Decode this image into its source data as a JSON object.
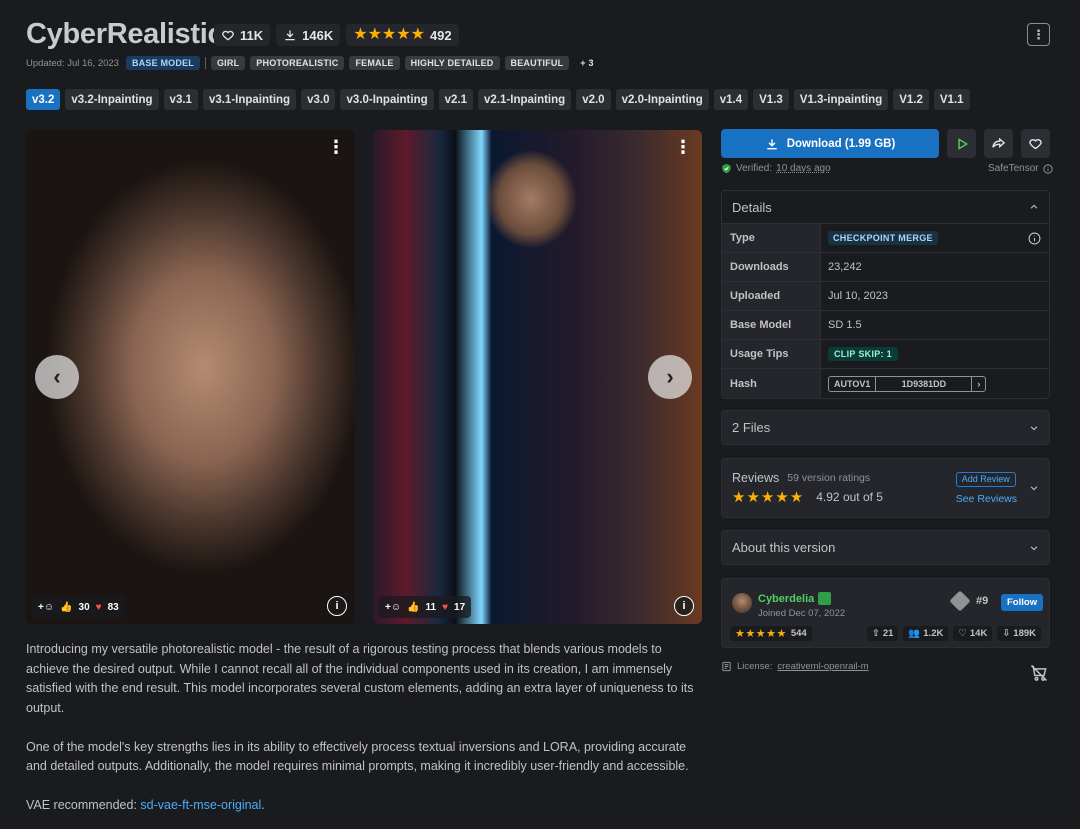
{
  "model": {
    "title": "CyberRealistic",
    "likes": "11K",
    "downloads": "146K",
    "rating_count": "492",
    "updated": "Updated: Jul 16, 2023",
    "tags": [
      "BASE MODEL",
      "GIRL",
      "PHOTOREALISTIC",
      "FEMALE",
      "HIGHLY DETAILED",
      "BEAUTIFUL",
      "+ 3"
    ]
  },
  "versions": [
    "v3.2",
    "v3.2-Inpainting",
    "v3.1",
    "v3.1-Inpainting",
    "v3.0",
    "v3.0-Inpainting",
    "v2.1",
    "v2.1-Inpainting",
    "v2.0",
    "v2.0-Inpainting",
    "v1.4",
    "V1.3",
    "V1.3-inpainting",
    "V1.2",
    "V1.1"
  ],
  "gallery": [
    {
      "likes": "30",
      "hearts": "83"
    },
    {
      "likes": "11",
      "hearts": "17"
    }
  ],
  "download": {
    "label": "Download (1.99 GB)",
    "verified_label": "Verified:",
    "verified_date": "10 days ago",
    "safe_label": "SafeTensor"
  },
  "details": {
    "heading": "Details",
    "type_label": "Type",
    "type_value": "CHECKPOINT MERGE",
    "downloads_label": "Downloads",
    "downloads_value": "23,242",
    "uploaded_label": "Uploaded",
    "uploaded_value": "Jul 10, 2023",
    "base_label": "Base Model",
    "base_value": "SD 1.5",
    "tips_label": "Usage Tips",
    "tips_value": "CLIP SKIP: 1",
    "hash_label": "Hash",
    "hash_type": "AUTOV1",
    "hash_value": "1D9381DD"
  },
  "files": {
    "label": "2 Files"
  },
  "reviews": {
    "label": "Reviews",
    "count": "59 version ratings",
    "stars": "★★★★★",
    "score": "4.92 out of 5",
    "add": "Add Review",
    "see": "See Reviews"
  },
  "about": {
    "label": "About this version"
  },
  "creator": {
    "name": "Cyberdelia",
    "joined": "Joined Dec 07, 2022",
    "rank": "#9",
    "follow": "Follow",
    "rating": "544",
    "uploads": "21",
    "followers": "1.2K",
    "favorites": "14K",
    "downloads": "189K"
  },
  "license": {
    "label": "License:",
    "value": "creativeml-openrail-m"
  },
  "description": {
    "p1": "Introducing my versatile photorealistic model - the result of a rigorous testing process that blends various models to achieve the desired output. While I cannot recall all of the individual components used in its creation, I am immensely satisfied with the end result. This model incorporates several custom elements, adding an extra layer of uniqueness to its output.",
    "p2": "One of the model's key strengths lies in its ability to effectively process textual inversions and LORA, providing accurate and detailed outputs. Additionally, the model requires minimal prompts, making it incredibly user-friendly and accessible.",
    "vae_label": "VAE recommended:",
    "vae_link": "sd-vae-ft-mse-original",
    "vae_end": "."
  },
  "colors": {
    "accent": "#1971c2",
    "star": "#fab005",
    "heart": "#fa5252",
    "creator": "#51cf66"
  }
}
